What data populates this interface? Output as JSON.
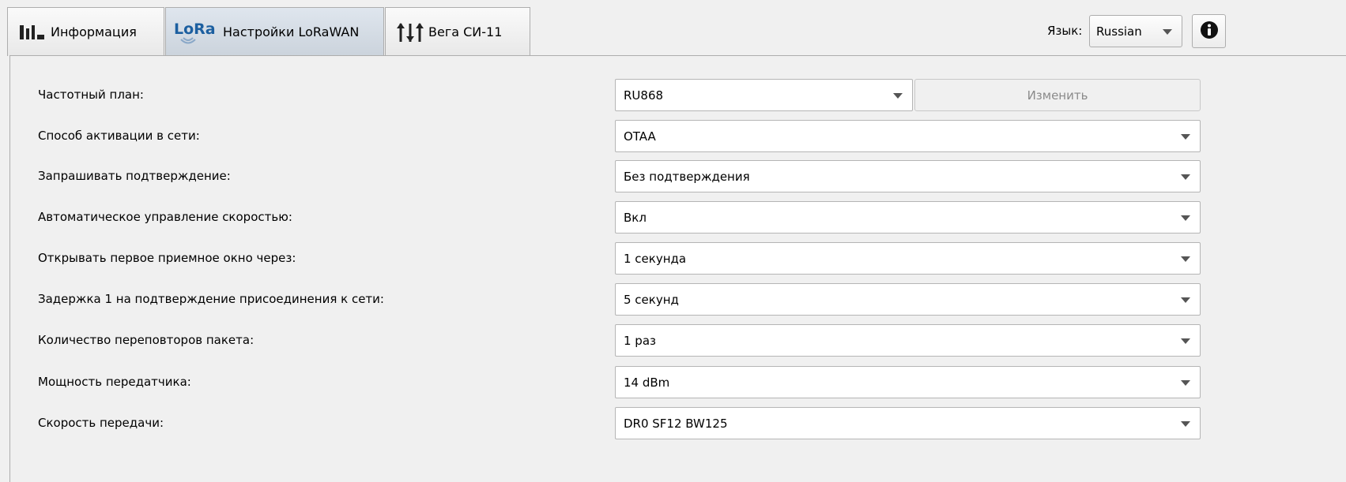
{
  "tabs": [
    {
      "label": "Информация",
      "icon": "bar-chart-icon",
      "active": false
    },
    {
      "label": "Настройки LoRaWAN",
      "icon": "lora-logo-icon",
      "icon_text": "LoRa",
      "active": true
    },
    {
      "label": "Вега СИ-11",
      "icon": "sliders-icon",
      "active": false
    }
  ],
  "language": {
    "label": "Язык:",
    "value": "Russian"
  },
  "info_button": {
    "icon": "info-icon"
  },
  "settings": [
    {
      "label": "Частотный план:",
      "value": "RU868",
      "action_label": "Изменить"
    },
    {
      "label": "Способ активации в сети:",
      "value": "OTAA"
    },
    {
      "label": "Запрашивать подтверждение:",
      "value": "Без подтверждения"
    },
    {
      "label": "Автоматическое управление скоростью:",
      "value": "Вкл"
    },
    {
      "label": "Открывать первое приемное окно через:",
      "value": "1 секунда"
    },
    {
      "label": "Задержка 1 на подтверждение присоединения к сети:",
      "value": "5 секунд"
    },
    {
      "label": "Количество переповторов пакета:",
      "value": "1 раз"
    },
    {
      "label": "Мощность передатчика:",
      "value": "14 dBm"
    },
    {
      "label": "Скорость передачи:",
      "value": "DR0 SF12 BW125"
    }
  ],
  "colors": {
    "active_tab": "#cbd3dc",
    "lora_blue": "#1c5fa0",
    "disabled_text": "#8a8a8a"
  }
}
